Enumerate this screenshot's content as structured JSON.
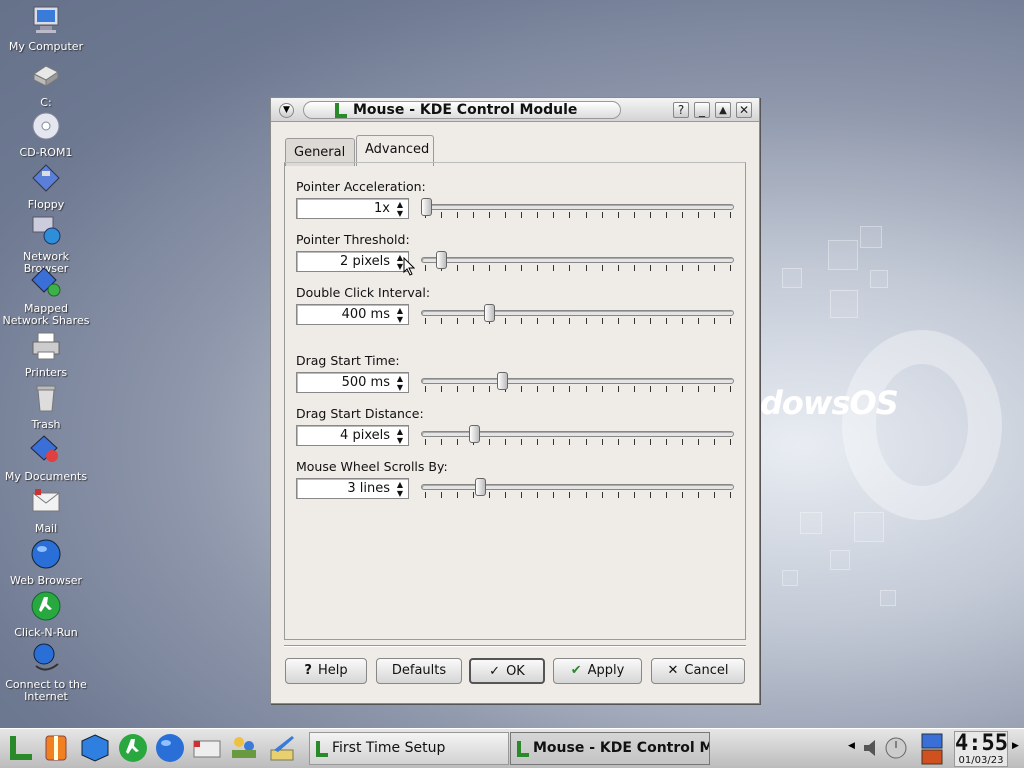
{
  "desktop": {
    "watermark": "dowsOS",
    "icons": [
      {
        "label": "My Computer",
        "icon": "computer-icon"
      },
      {
        "label": "C:",
        "icon": "hard-drive-icon"
      },
      {
        "label": "CD-ROM1",
        "icon": "cdrom-icon"
      },
      {
        "label": "Floppy",
        "icon": "floppy-icon"
      },
      {
        "label": "Network Browser",
        "icon": "network-icon"
      },
      {
        "label": "Mapped Network Shares",
        "icon": "network-share-icon"
      },
      {
        "label": "Printers",
        "icon": "printer-icon"
      },
      {
        "label": "Trash",
        "icon": "trash-icon"
      },
      {
        "label": "My Documents",
        "icon": "documents-icon"
      },
      {
        "label": "Mail",
        "icon": "mail-icon"
      },
      {
        "label": "Web Browser",
        "icon": "globe-icon"
      },
      {
        "label": "Click-N-Run",
        "icon": "runner-icon"
      },
      {
        "label": "Connect to the Internet",
        "icon": "connect-icon"
      }
    ]
  },
  "window": {
    "title": "Mouse - KDE Control Module",
    "buttons": {
      "help": "?",
      "minimize": "_",
      "maximize": "▲",
      "close": "✕"
    },
    "tabs": [
      {
        "label": "General",
        "active": false
      },
      {
        "label": "Advanced",
        "active": true
      }
    ],
    "fields": [
      {
        "label": "Pointer Acceleration:",
        "value": "1x",
        "slider_fraction": 0.0
      },
      {
        "label": "Pointer Threshold:",
        "value": "2 pixels",
        "slider_fraction": 0.05
      },
      {
        "label": "Double Click Interval:",
        "value": "400 ms",
        "slider_fraction": 0.21
      },
      {
        "label": "Drag Start Time:",
        "value": "500 ms",
        "slider_fraction": 0.25
      },
      {
        "label": "Drag Start Distance:",
        "value": "4 pixels",
        "slider_fraction": 0.16
      },
      {
        "label": "Mouse Wheel Scrolls By:",
        "value": "3 lines",
        "slider_fraction": 0.18
      }
    ],
    "footer_buttons": {
      "help": "Help",
      "defaults": "Defaults",
      "ok": "OK",
      "apply": "Apply",
      "cancel": "Cancel"
    }
  },
  "taskbar": {
    "tasks": [
      {
        "label": "First Time Setup",
        "active": false
      },
      {
        "label": "Mouse - KDE Control Mo",
        "active": true
      }
    ],
    "clock": {
      "time": "4:55",
      "date": "01/03/23"
    },
    "colors": {
      "accent_green": "#2a8a2a",
      "accent_blue": "#2a5fc8"
    }
  }
}
